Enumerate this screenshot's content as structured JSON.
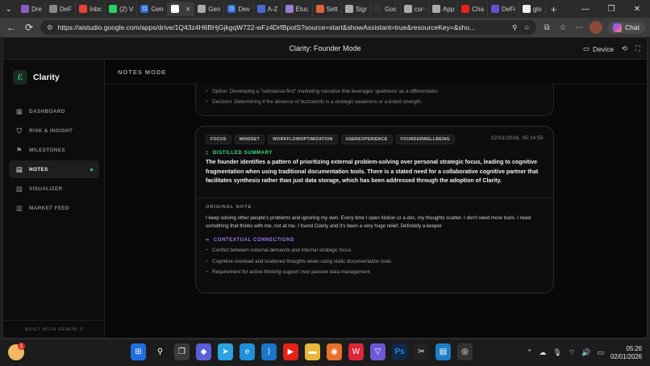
{
  "browser": {
    "tabs": [
      {
        "label": "Dre",
        "color": "#8a5cc7"
      },
      {
        "label": "DeF",
        "color": "#888888"
      },
      {
        "label": "Inbc",
        "color": "#ea4335"
      },
      {
        "label": "(2) V",
        "color": "#25d366"
      },
      {
        "label": "Gen",
        "color": "#2f6fd6",
        "glyph": "D"
      },
      {
        "label": "",
        "color": "#ffffff",
        "active": true
      },
      {
        "label": "Gen",
        "color": "#aaaaaa"
      },
      {
        "label": "Dev",
        "color": "#2f6fd6",
        "glyph": "D"
      },
      {
        "label": "A-Z",
        "color": "#4a6bd6"
      },
      {
        "label": "Étuc",
        "color": "#9a7bd6"
      },
      {
        "label": "Sett",
        "color": "#e0603a"
      },
      {
        "label": "Sigr",
        "color": "#aaaaaa"
      },
      {
        "label": "Goc",
        "color": "#333333"
      },
      {
        "label": "csr-",
        "color": "#aaaaaa"
      },
      {
        "label": "App",
        "color": "#aaaaaa"
      },
      {
        "label": "Cha",
        "color": "#e62117"
      },
      {
        "label": "DeFi",
        "color": "#6c4ad6"
      },
      {
        "label": "glo",
        "color": "#eeeeee"
      }
    ],
    "new_tab": "+",
    "url": "https://aistudio.google.com/apps/drive/1Q43z4H6BHjGjkgqW722-wFz4DrfBpotS?source=start&showAssistant=true&resourceKey=&sho...",
    "chat_label": "Chat"
  },
  "app": {
    "title": "Clarity: Founder Mode",
    "device_label": "Device"
  },
  "sidebar": {
    "brand": "Clarity",
    "items": [
      {
        "label": "DASHBOARD",
        "icon": "grid-icon"
      },
      {
        "label": "RISK & INSIGHT",
        "icon": "shield-icon"
      },
      {
        "label": "MILESTONES",
        "icon": "flag-icon"
      },
      {
        "label": "NOTES",
        "icon": "note-icon",
        "active": true
      },
      {
        "label": "VISUALIZER",
        "icon": "image-icon"
      },
      {
        "label": "MARKET FEED",
        "icon": "feed-icon"
      }
    ],
    "footer": "BUILT WITH GEMINI 3"
  },
  "main": {
    "mode_title": "NOTES MODE",
    "previous_card": {
      "bullets": [
        "Option: Developing a \"substance-first\" marketing narrative that leverages 'quietness' as a differentiator.",
        "Decision: Determining if the absence of buzzwords is a strategic weakness or a brand strength."
      ]
    },
    "note": {
      "tags": [
        "FOCUS",
        "MINDSET",
        "WORKFLOWOPTIMIZATION",
        "USEREXPERIENCE",
        "FOUNDERWELLBEING"
      ],
      "timestamp": "02/01/2026, 05:24:55",
      "distilled_label": "DISTILLED SUMMARY",
      "distilled_summary": "The founder identifies a pattern of prioritizing external problem-solving over personal strategic focus, leading to cognitive fragmentation when using traditional documentation tools. There is a stated need for a collaborative cognitive partner that facilitates synthesis rather than just data storage, which has been addressed through the adoption of Clarity.",
      "original_label": "ORIGINAL NOTE",
      "original_note": "I keep solving other people's problems and ignoring my own. Every time I open Notion or a doc, my thoughts scatter. I don't need more tools. I need something that thinks with me, not at me. I found Clarity and it's been a very huge relief. Definitely a keeper",
      "connections_label": "CONTEXTUAL CONNECTIONS",
      "connections": [
        "Conflict between external demands and internal strategic focus",
        "Cognitive overload and scattered thoughts when using static documentation tools",
        "Requirement for active thinking support over passive data management"
      ]
    }
  },
  "taskbar": {
    "weather_badge": "1",
    "time": "05:26",
    "date": "02/01/2026",
    "colors": {
      "accent": "#3ddc84",
      "purple": "#9b7cf2"
    }
  }
}
